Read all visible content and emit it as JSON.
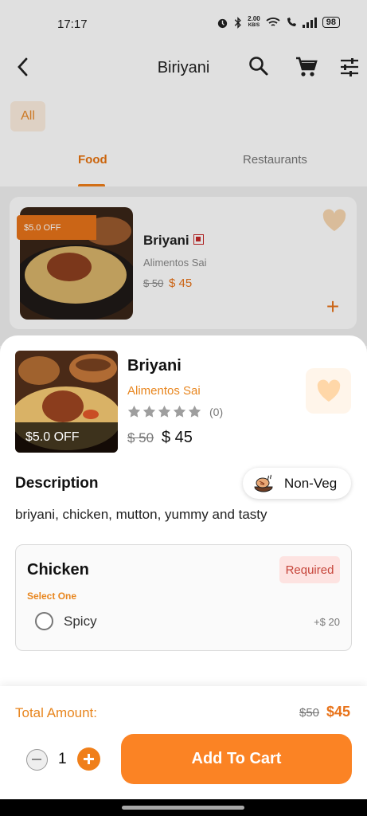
{
  "status_bar": {
    "time": "17:17",
    "net_speed_value": "2.00",
    "net_speed_unit": "KB/S",
    "battery": "98"
  },
  "header": {
    "title": "Biriyani"
  },
  "categories": {
    "all_label": "All"
  },
  "tabs": [
    {
      "label": "Food"
    },
    {
      "label": "Restaurants"
    }
  ],
  "list_card": {
    "discount": "$5.0 OFF",
    "title": "Briyani",
    "restaurant": "Alimentos Sai",
    "old_price": "$ 50",
    "new_price": "$ 45"
  },
  "sheet": {
    "discount": "$5.0 OFF",
    "title": "Briyani",
    "restaurant": "Alimentos Sai",
    "rating_count": "(0)",
    "old_price": "$ 50",
    "new_price": "$ 45",
    "description_title": "Description",
    "diet_label": "Non-Veg",
    "description": "briyani, chicken, mutton, yummy and tasty",
    "option_group": {
      "title": "Chicken",
      "required_label": "Required",
      "hint": "Select One",
      "options": [
        {
          "label": "Spicy",
          "price": "+$ 20"
        }
      ]
    }
  },
  "footer": {
    "total_label": "Total Amount:",
    "total_old": "$50",
    "total_new": "$45",
    "quantity": "1",
    "add_to_cart_label": "Add To Cart"
  },
  "colors": {
    "accent": "#fb8324",
    "accent_text": "#e8861f",
    "required_bg": "#fde3e1",
    "required_text": "#c6453a"
  }
}
